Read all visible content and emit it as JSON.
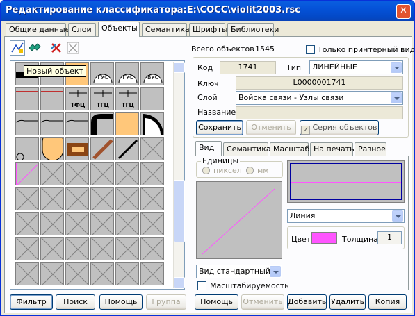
{
  "window": {
    "title": "Редактирование классификатора:E:\\COCC\\violit2003.rsc",
    "close_glyph": "✕"
  },
  "main_tabs": [
    {
      "label": "Общие данные"
    },
    {
      "label": "Слои"
    },
    {
      "label": "Объекты"
    },
    {
      "label": "Семантика"
    },
    {
      "label": "Шрифты"
    },
    {
      "label": "Библиотеки"
    }
  ],
  "toolbar": {
    "tooltip": "Новый объект"
  },
  "grid": {
    "cell_labels": {
      "gus1": "ГУС",
      "gus2": "ГУС",
      "vus": "ВУС",
      "tfc": "ТФЦ",
      "tgc1": "ТГЦ",
      "tgc2": "ТГЦ"
    }
  },
  "left_buttons": {
    "filter": "Фильтр",
    "search": "Поиск",
    "help": "Помощь",
    "group": "Группа"
  },
  "summary": {
    "total_label": "Всего объектов",
    "total_value": "1545",
    "printer_only": "Только принтерный вид"
  },
  "object": {
    "code_label": "Код",
    "code_value": "1741",
    "type_label": "Тип",
    "type_value": "ЛИНЕЙНЫЕ",
    "key_label": "Ключ",
    "key_value": "L0000001741",
    "layer_label": "Слой",
    "layer_value": "Войска связи - Узлы связи",
    "name_label": "Название",
    "name_value": ""
  },
  "object_buttons": {
    "save": "Сохранить",
    "cancel": "Отменить",
    "series": "Серия объектов"
  },
  "view_tabs": [
    {
      "label": "Вид"
    },
    {
      "label": "Семантика"
    },
    {
      "label": "Масштаб"
    },
    {
      "label": "На печать"
    },
    {
      "label": "Разное"
    }
  ],
  "view": {
    "units_group": "Единицы",
    "unit_pixel": "пиксел",
    "unit_mm": "мм",
    "style_combo": "Вид стандартный",
    "scalable": "Масштабируемость",
    "type_combo": "Линия",
    "color_label": "Цвет",
    "color_value": "#FF55FF",
    "thickness_label": "Толщина",
    "thickness_value": "1"
  },
  "bottom_buttons": {
    "help": "Помощь",
    "cancel": "Отменить",
    "add": "Добавить",
    "delete": "Удалить",
    "copy": "Копия"
  }
}
